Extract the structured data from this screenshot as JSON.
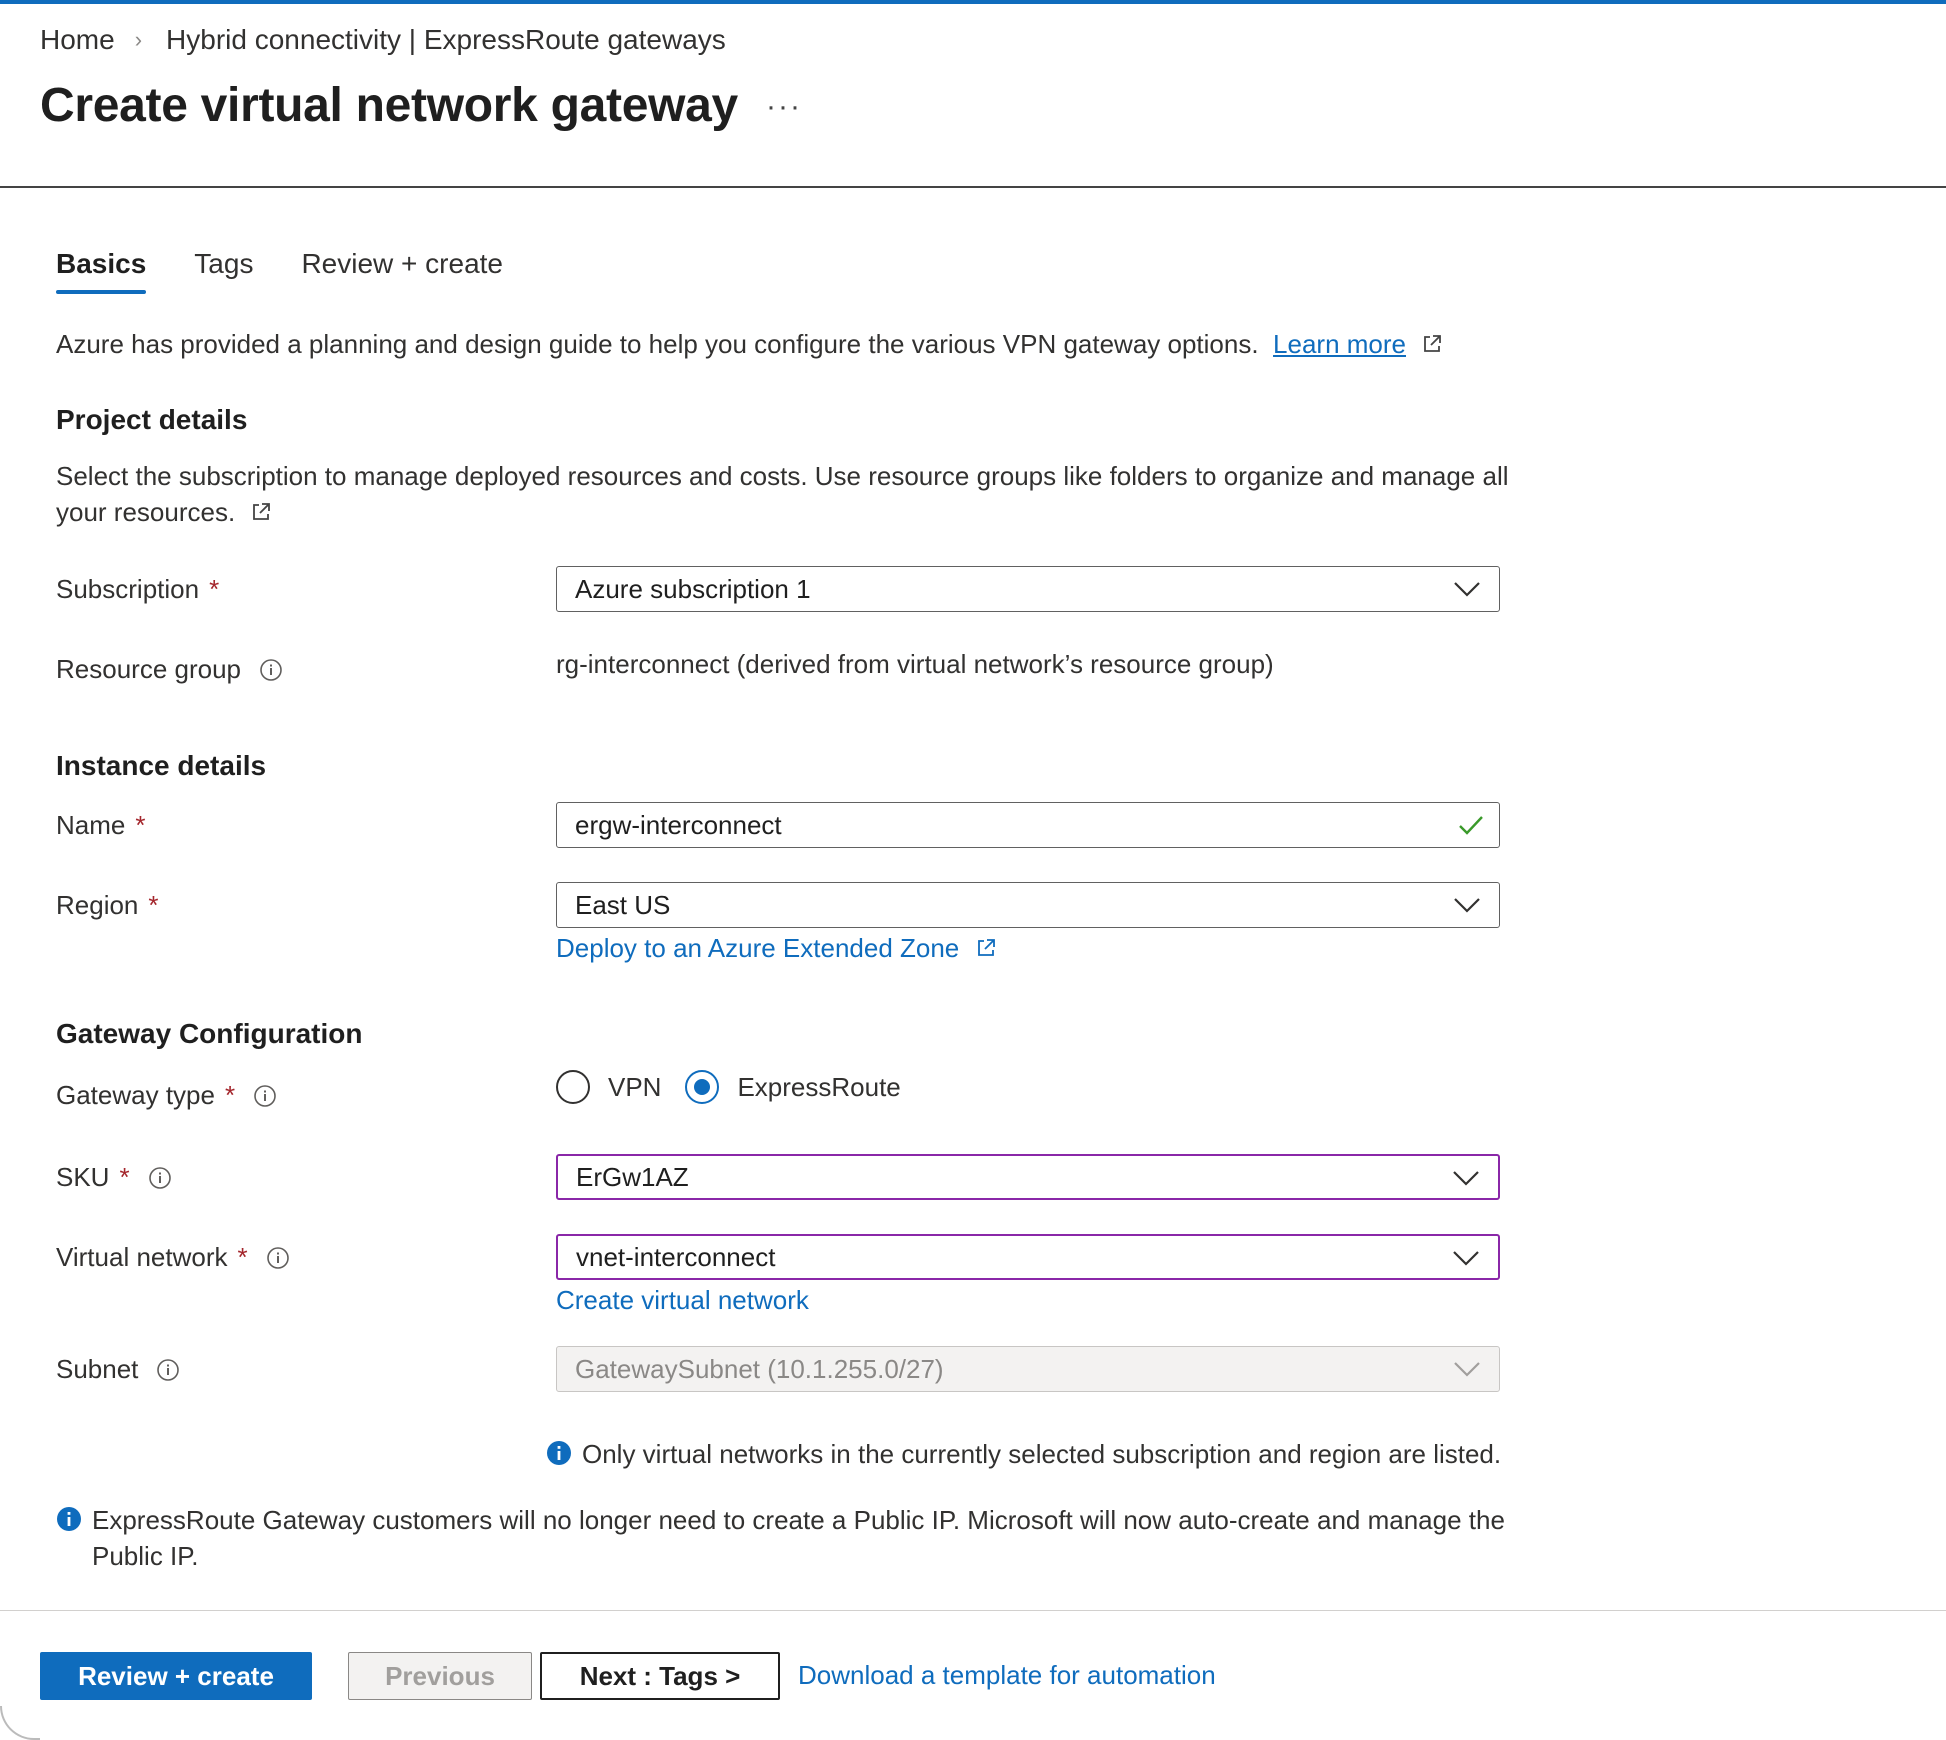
{
  "breadcrumb": {
    "home": "Home",
    "separator": "›",
    "parent": "Hybrid connectivity | ExpressRoute gateways"
  },
  "page": {
    "title": "Create virtual network gateway",
    "more": "···"
  },
  "tabs": [
    {
      "label": "Basics",
      "active": true
    },
    {
      "label": "Tags",
      "active": false
    },
    {
      "label": "Review + create",
      "active": false
    }
  ],
  "intro": {
    "text": "Azure has provided a planning and design guide to help you configure the various VPN gateway options.",
    "link": "Learn more"
  },
  "project": {
    "heading": "Project details",
    "description": "Select the subscription to manage deployed resources and costs. Use resource groups like folders to organize and manage all your resources.",
    "subscription_label": "Subscription",
    "subscription_value": "Azure subscription 1",
    "resource_group_label": "Resource group",
    "resource_group_value": "rg-interconnect (derived from virtual network’s resource group)"
  },
  "instance": {
    "heading": "Instance details",
    "name_label": "Name",
    "name_value": "ergw-interconnect",
    "region_label": "Region",
    "region_value": "East US",
    "extended_zone_link": "Deploy to an Azure Extended Zone"
  },
  "gateway": {
    "heading": "Gateway Configuration",
    "type_label": "Gateway type",
    "type_options": [
      "VPN",
      "ExpressRoute"
    ],
    "type_selected": "ExpressRoute",
    "sku_label": "SKU",
    "sku_value": "ErGw1AZ",
    "vnet_label": "Virtual network",
    "vnet_value": "vnet-interconnect",
    "create_vnet_link": "Create virtual network",
    "subnet_label": "Subnet",
    "subnet_value": "GatewaySubnet (10.1.255.0/27)",
    "vnet_note": "Only virtual networks in the currently selected subscription and region are listed.",
    "public_ip_note": "ExpressRoute Gateway customers will no longer need to create a Public IP. Microsoft will now auto-create and manage the Public IP."
  },
  "required_marker": "*",
  "footer": {
    "review_create": "Review + create",
    "previous": "Previous",
    "next": "Next : Tags >",
    "download_link": "Download a template for automation"
  },
  "colors": {
    "accent": "#0f6cbd",
    "required": "#a4262c",
    "focus_border": "#8a27a8",
    "valid_check": "#3a9a2a"
  }
}
